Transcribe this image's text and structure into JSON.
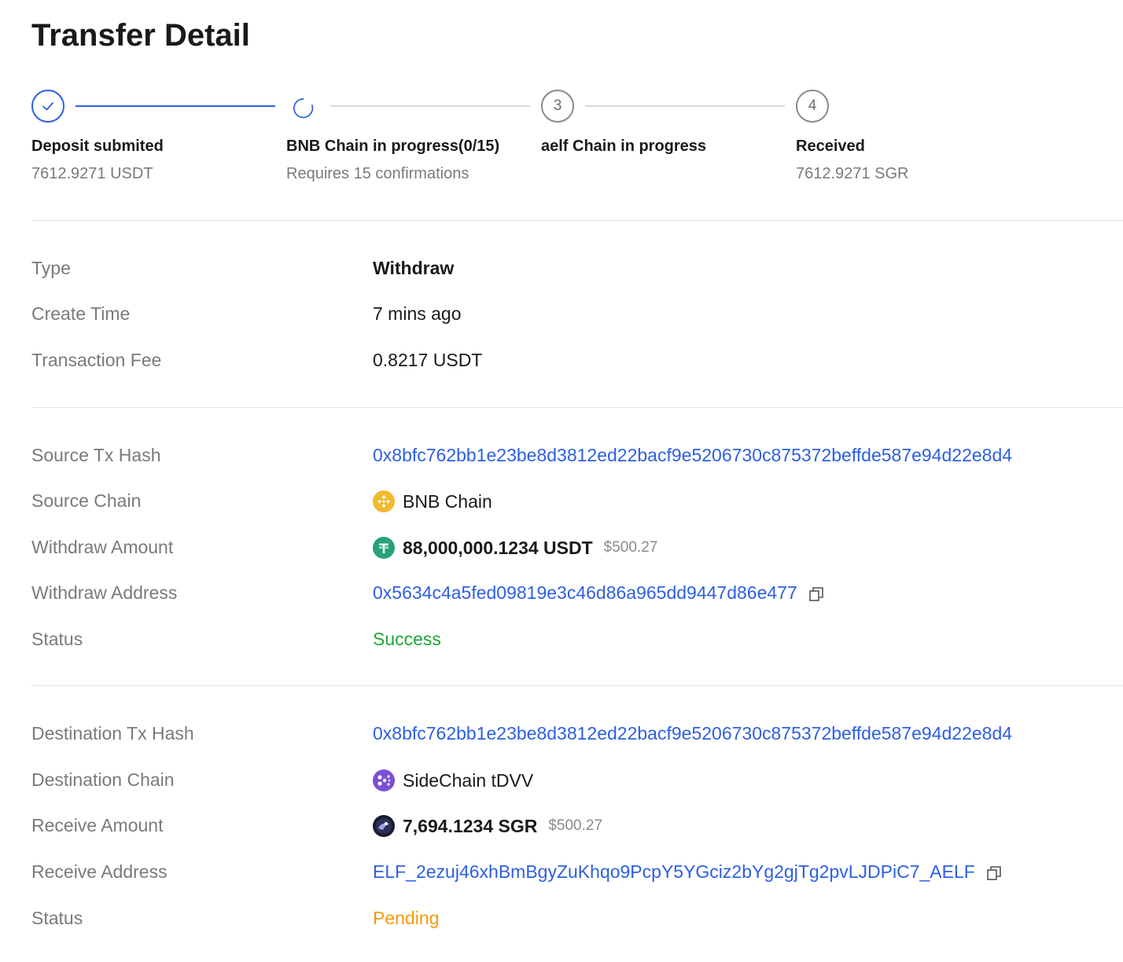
{
  "page": {
    "title": "Transfer Detail"
  },
  "steps": [
    {
      "title": "Deposit submited",
      "subtitle": "7612.9271 USDT",
      "state": "done",
      "number": "1"
    },
    {
      "title": "BNB Chain in progress(0/15)",
      "subtitle": "Requires 15 confirmations",
      "state": "loading",
      "number": "2"
    },
    {
      "title": "aelf Chain in progress",
      "subtitle": "",
      "state": "waiting",
      "number": "3"
    },
    {
      "title": "Received",
      "subtitle": "7612.9271 SGR",
      "state": "waiting",
      "number": "4"
    }
  ],
  "summary": {
    "type_label": "Type",
    "type_value": "Withdraw",
    "create_time_label": "Create Time",
    "create_time_value": "7 mins ago",
    "fee_label": "Transaction Fee",
    "fee_value": "0.8217 USDT"
  },
  "source": {
    "tx_hash_label": "Source Tx Hash",
    "tx_hash_value": "0x8bfc762bb1e23be8d3812ed22bacf9e5206730c875372beffde587e94d22e8d4",
    "chain_label": "Source Chain",
    "chain_value": "BNB Chain",
    "chain_icon": "bnb-chain-icon",
    "amount_label": "Withdraw Amount",
    "amount_value": "88,000,000.1234 USDT",
    "amount_usd": "$500.27",
    "amount_icon": "usdt-token-icon",
    "address_label": "Withdraw Address",
    "address_value": "0x5634c4a5fed09819e3c46d86a965dd9447d86e477",
    "status_label": "Status",
    "status_value": "Success"
  },
  "destination": {
    "tx_hash_label": "Destination Tx Hash",
    "tx_hash_value": "0x8bfc762bb1e23be8d3812ed22bacf9e5206730c875372beffde587e94d22e8d4",
    "chain_label": "Destination Chain",
    "chain_value": "SideChain tDVV",
    "chain_icon": "aelf-sidechain-icon",
    "amount_label": "Receive Amount",
    "amount_value": "7,694.1234 SGR",
    "amount_usd": "$500.27",
    "amount_icon": "sgr-token-icon",
    "address_label": "Receive Address",
    "address_value": "ELF_2ezuj46xhBmBgyZuKhqo9PcpY5YGciz2bYg2gjTg2pvLJDPiC7_AELF",
    "status_label": "Status",
    "status_value": "Pending"
  },
  "colors": {
    "accent": "#2d5fe3",
    "success": "#1ea637",
    "pending": "#f59a0b",
    "label": "#7a7a7a"
  }
}
